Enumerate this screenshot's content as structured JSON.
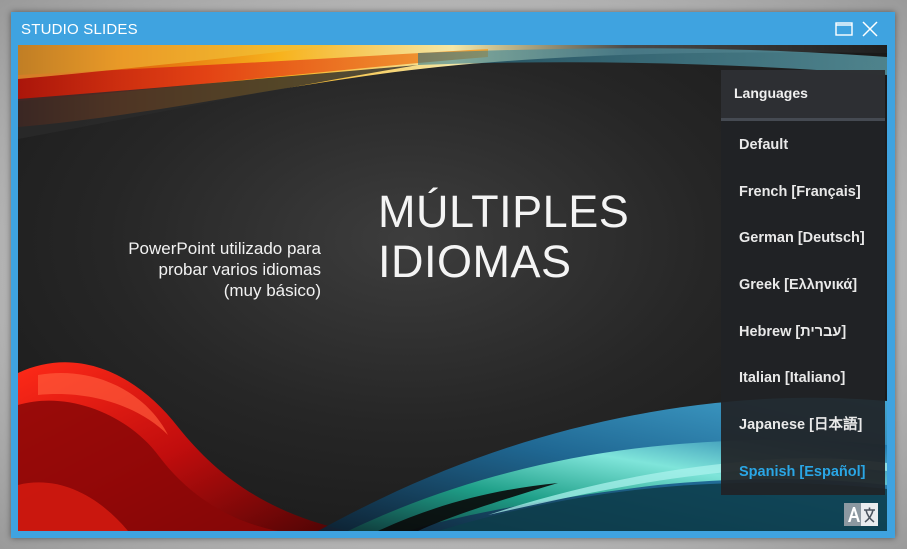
{
  "window": {
    "title": "STUDIO SLIDES"
  },
  "slide": {
    "subtitle": "PowerPoint utilizado para\nprobar varios idiomas\n(muy básico)",
    "heading_line1": "MÚLTIPLES",
    "heading_line2": "IDIOMAS"
  },
  "languages": {
    "header": "Languages",
    "items": [
      {
        "label": "Default"
      },
      {
        "label": "French [Français]"
      },
      {
        "label": "German [Deutsch]"
      },
      {
        "label": "Greek [Ελληνικά]"
      },
      {
        "label": "Hebrew [עברית]"
      },
      {
        "label": "Italian [Italiano]"
      },
      {
        "label": "Japanese [日本語]"
      },
      {
        "label": "Spanish [Español]"
      }
    ],
    "selected_index": 7
  },
  "icons": {
    "maximize": "maximize-icon",
    "close": "close-icon",
    "translate": "translate-icon"
  },
  "colors": {
    "frame": "#3fa3e0",
    "selected_language": "#2aa6e5",
    "panel": "#202226"
  }
}
